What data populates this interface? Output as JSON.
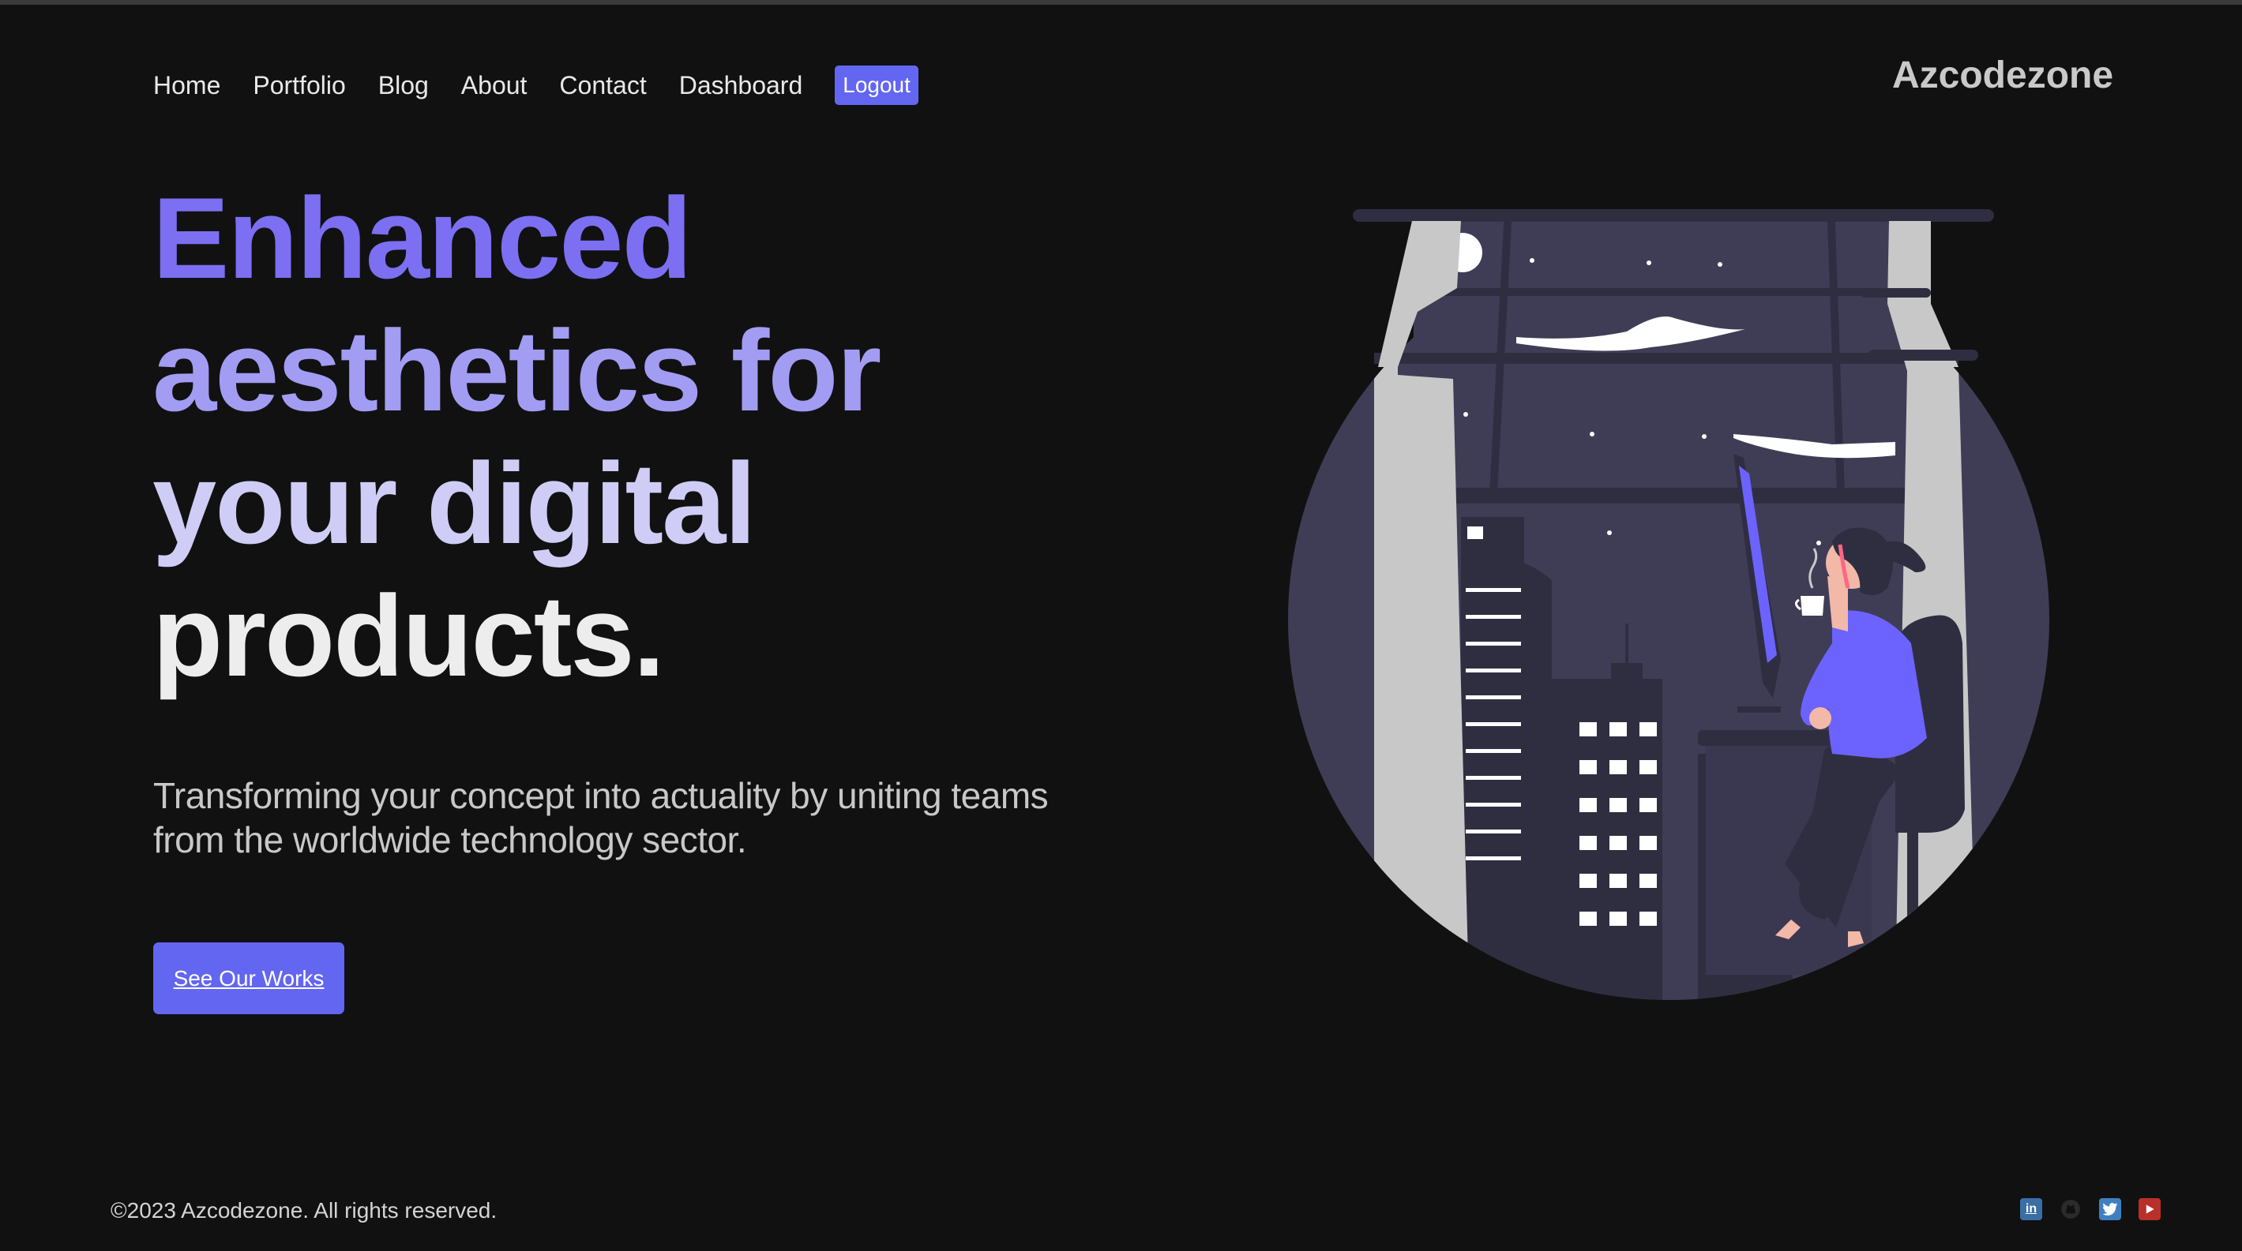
{
  "nav": {
    "items": [
      "Home",
      "Portfolio",
      "Blog",
      "About",
      "Contact",
      "Dashboard"
    ],
    "logout": "Logout"
  },
  "brand": "Azcodezone",
  "hero": {
    "headline": [
      "Enhanced",
      "aesthetics for",
      "your digital",
      "products."
    ],
    "subtitle": "Transforming your concept into actuality by uniting teams from the worldwide technology sector.",
    "cta": "See Our Works"
  },
  "footer": {
    "copyright": "©2023 Azcodezone. All rights reserved.",
    "socials": [
      {
        "icon": "linkedin-icon",
        "glyph": "in",
        "color": "#3a6ea5"
      },
      {
        "icon": "github-icon",
        "glyph": "",
        "color": "#2a2a2a"
      },
      {
        "icon": "twitter-icon",
        "glyph": "",
        "color": "#3f7fc0"
      },
      {
        "icon": "youtube-icon",
        "glyph": "",
        "color": "#b8302a"
      }
    ]
  },
  "colors": {
    "background": "#111111",
    "accent": "#6366f1",
    "headline_1": "#7c6ff2",
    "headline_2": "#a29cf3",
    "headline_3": "#cfcdf6",
    "headline_4": "#ededee"
  }
}
